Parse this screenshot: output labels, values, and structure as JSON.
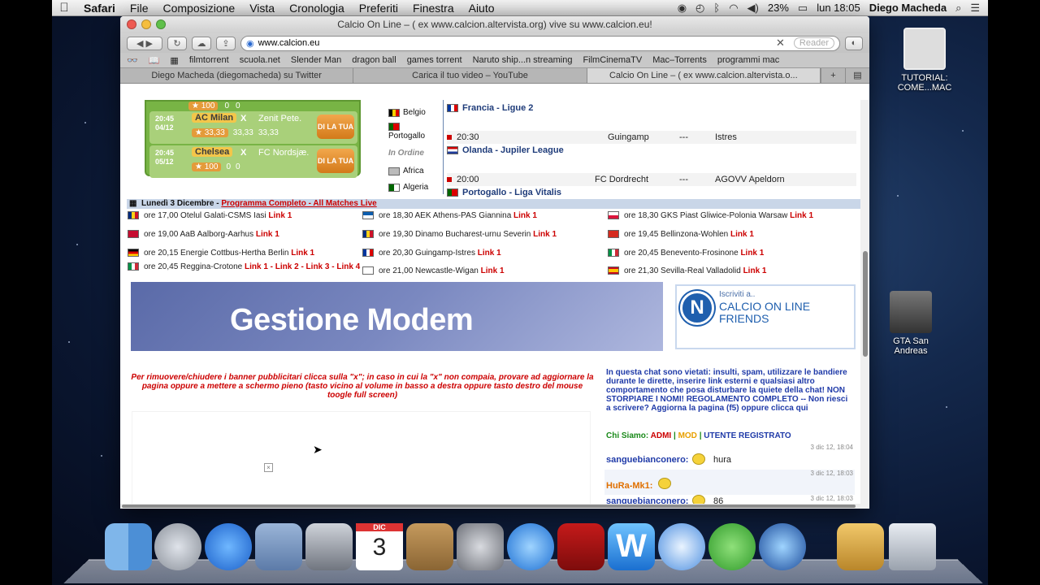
{
  "menubar": {
    "app": "Safari",
    "items": [
      "File",
      "Composizione",
      "Vista",
      "Cronologia",
      "Preferiti",
      "Finestra",
      "Aiuto"
    ],
    "battery": "23%",
    "clock": "lun 18:05",
    "user": "Diego Macheda"
  },
  "window": {
    "title": "Calcio On Line – ( ex www.calcion.altervista.org) vive su www.calcion.eu!",
    "url": "www.calcion.eu",
    "reader_label": "Reader",
    "bookmarks": [
      "filmtorrent",
      "scuola.net",
      "Slender Man",
      "dragon ball",
      "games torrent",
      "Naruto ship...n streaming",
      "FilmCinemaTV",
      "Mac–Torrents",
      "programmi mac"
    ],
    "tabs": [
      {
        "label": "Diego Macheda (diegomacheda) su Twitter"
      },
      {
        "label": "Carica il tuo video – YouTube"
      },
      {
        "label": "Calcio On Line – ( ex www.calcion.altervista.o..."
      }
    ]
  },
  "matches": [
    {
      "time": "20:45",
      "date": "04/12",
      "team1": "AC Milan",
      "x": "X",
      "team2": "Zenit Pete.",
      "odd1": "33,33",
      "oddx": "33,33",
      "odd2": "33,33",
      "btn": "DI LA TUA"
    },
    {
      "time": "20:45",
      "date": "05/12",
      "team1": "Chelsea",
      "x": "X",
      "team2": "FC Nordsjæ.",
      "odd1": "100",
      "oddx": "0",
      "odd2": "0",
      "btn": "DI LA TUA"
    }
  ],
  "top_odds": {
    "odd1": "100",
    "oddx": "0",
    "odd2": "0"
  },
  "countries": [
    "Belgio",
    "Portogallo",
    "In Ordine",
    "Africa",
    "Algeria"
  ],
  "leagues": {
    "l1": "Francia - Ligue 2",
    "m1": {
      "time": "20:30",
      "home": "Guingamp",
      "sep": "---",
      "away": "Istres"
    },
    "l2": "Olanda - Jupiler League",
    "m2": {
      "time": "20:00",
      "home": "FC Dordrecht",
      "sep": "---",
      "away": "AGOVV Apeldorn"
    },
    "l3": "Portogallo - Liga Vitalis"
  },
  "datebar": {
    "date": "Lunedì 3 Dicembre - ",
    "link": "Programma Completo - All Matches Live"
  },
  "schedule": [
    {
      "text": "ore 17,00 Otelul Galati-CSMS Iasi ",
      "link": "Link 1"
    },
    {
      "text": "ore 18,30 AEK Athens-PAS Giannina ",
      "link": "Link 1"
    },
    {
      "text": "ore 18,30 GKS Piast Gliwice-Polonia Warsaw ",
      "link": "Link 1"
    },
    {
      "text": "ore 19,00 AaB Aalborg-Aarhus ",
      "link": "Link 1"
    },
    {
      "text": "ore 19,30 Dinamo Bucharest-urnu Severin ",
      "link": "Link 1"
    },
    {
      "text": "ore 19,45 Bellinzona-Wohlen ",
      "link": "Link 1"
    },
    {
      "text": "ore 20,15 Energie Cottbus-Hertha Berlin ",
      "link": "Link 1"
    },
    {
      "text": "ore 20,30 Guingamp-Istres ",
      "link": "Link 1"
    },
    {
      "text": "ore 20,45 Benevento-Frosinone ",
      "link": "Link 1"
    },
    {
      "text": "ore 20,45 Reggina-Crotone ",
      "link": "Link 1 - Link 2 - Link 3 - Link 4"
    },
    {
      "text": "ore 21,00 Newcastle-Wigan ",
      "link": "Link 1"
    },
    {
      "text": "ore 21,30 Sevilla-Real Valladolid ",
      "link": "Link 1"
    }
  ],
  "banner": {
    "text": "Gestione Modem"
  },
  "friends": {
    "small": "Iscriviti a..",
    "line1": "CALCIO ON LINE",
    "line2": "FRIENDS",
    "logo": "N"
  },
  "note": "Per rimuovere/chiudere i banner pubblicitari clicca sulla \"x\"; in caso in cui la \"x\" non compaia, provare ad aggiornare la pagina oppure a mettere a schermo pieno (tasto vicino al volume in basso a destra oppure tasto destro del mouse toogle full screen)",
  "chat": {
    "rules": "In questa chat sono vietati: insulti, spam, utilizzare le bandiere durante le dirette, inserire link esterni e qualsiasi altro comportamento che posa disturbare la quiete della chat! NON STORPIARE I NOMI! REGOLAMENTO COMPLETO -- Non riesci a scrivere? Aggiorna la pagina (f5) oppure clicca qui",
    "who_label": "Chi Siamo:",
    "admi": "ADMI",
    "mod": "MOD",
    "registrato": "UTENTE REGISTRATO",
    "messages": [
      {
        "ts": "3 dic 12, 18:04",
        "user": "sanguebianconero:",
        "text": "hura"
      },
      {
        "ts": "3 dic 12, 18:03",
        "user": "HuRa-Mk1:",
        "text": ""
      },
      {
        "ts": "3 dic 12, 18:03",
        "user": "sanguebianconero:",
        "text": "86"
      }
    ]
  },
  "desktop_icons": [
    {
      "label": "TUTORIAL: COME...MAC"
    },
    {
      "label": "GTA San Andreas"
    }
  ],
  "calendar": {
    "month": "DIC",
    "day": "3"
  }
}
